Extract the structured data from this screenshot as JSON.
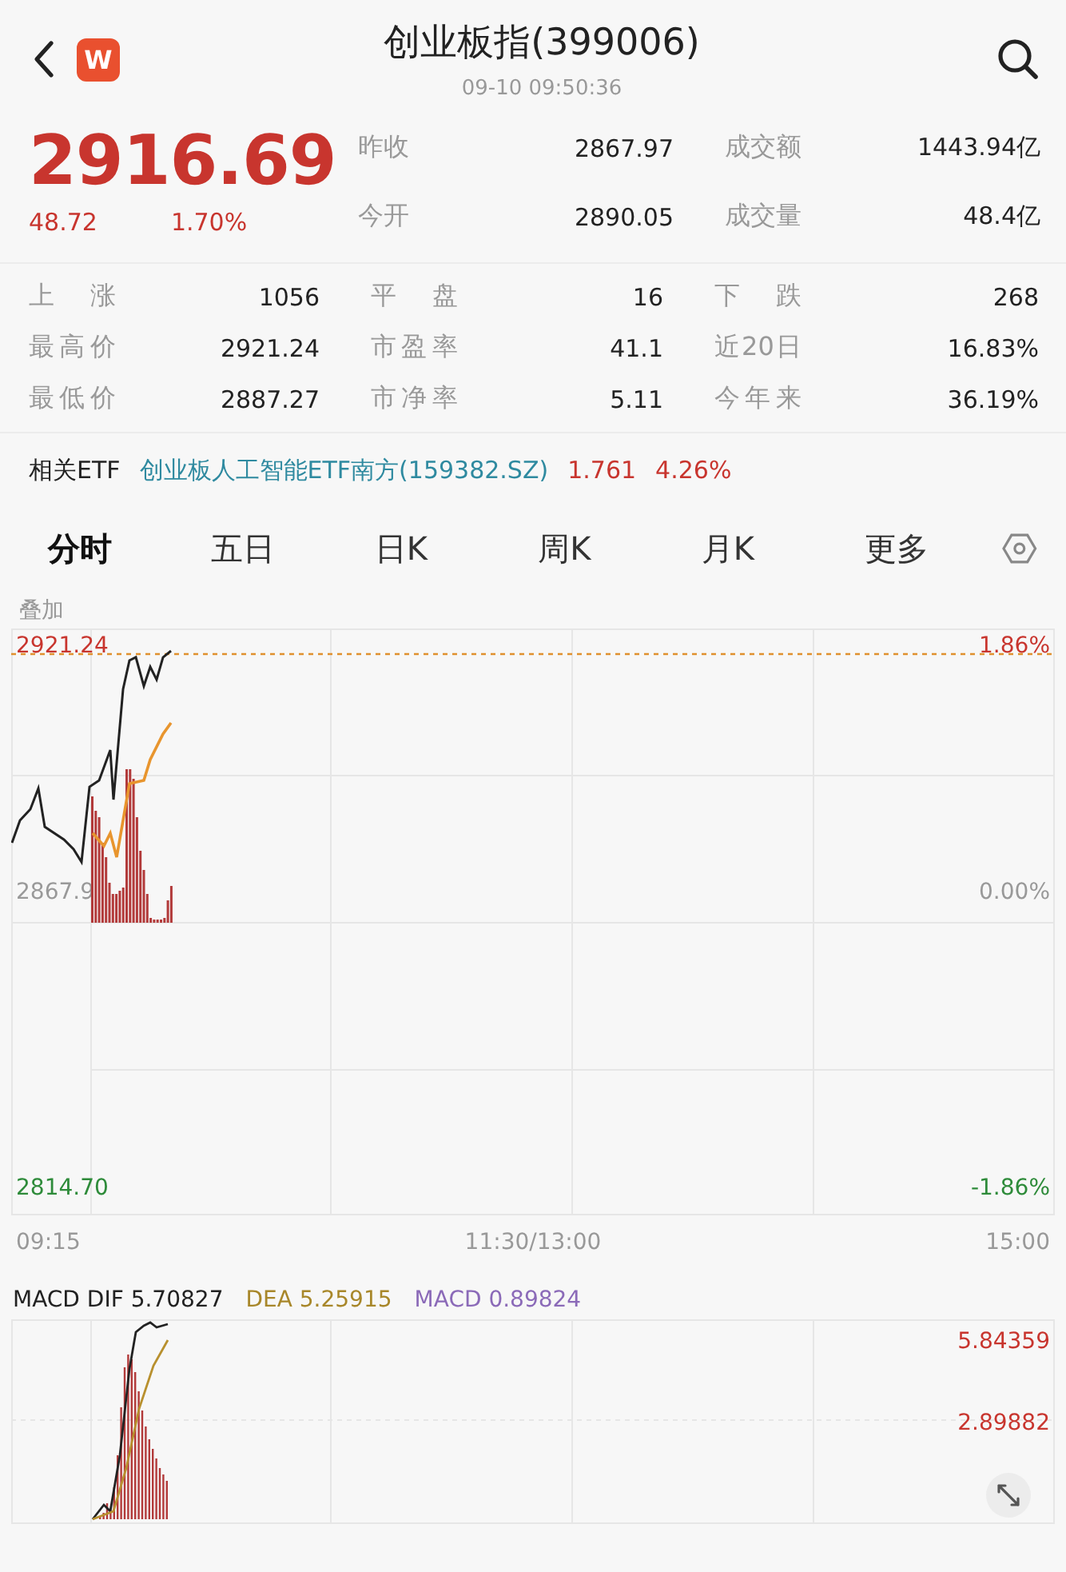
{
  "header": {
    "logo": "W",
    "title": "创业板指(399006)",
    "datetime": "09-10 09:50:36"
  },
  "quote": {
    "price": "2916.69",
    "change": "48.72",
    "change_pct": "1.70%"
  },
  "top_stats": [
    {
      "label": "昨收",
      "value": "2867.97"
    },
    {
      "label": "成交额",
      "value": "1443.94亿"
    },
    {
      "label": "今开",
      "value": "2890.05"
    },
    {
      "label": "成交量",
      "value": "48.4亿"
    }
  ],
  "stats": [
    {
      "label": "上涨",
      "value": "1056"
    },
    {
      "label": "平盘",
      "value": "16"
    },
    {
      "label": "下跌",
      "value": "268"
    },
    {
      "label": "最高价",
      "value": "2921.24"
    },
    {
      "label": "市盈率",
      "value": "41.1"
    },
    {
      "label": "近20日",
      "value": "16.83%"
    },
    {
      "label": "最低价",
      "value": "2887.27"
    },
    {
      "label": "市净率",
      "value": "5.11"
    },
    {
      "label": "今年来",
      "value": "36.19%"
    }
  ],
  "etf": {
    "label": "相关ETF",
    "name": "创业板人工智能ETF南方(159382.SZ)",
    "price": "1.761",
    "change_pct": "4.26%"
  },
  "tabs": [
    {
      "label": "分时",
      "selected": true
    },
    {
      "label": "五日",
      "selected": false
    },
    {
      "label": "日K",
      "selected": false
    },
    {
      "label": "周K",
      "selected": false
    },
    {
      "label": "月K",
      "selected": false
    },
    {
      "label": "更多",
      "selected": false
    }
  ],
  "price_chart": {
    "overlay": "叠加",
    "high_label": "2921.24",
    "high_pct": "1.86%",
    "base_label": "2867.9",
    "base_pct": "0.00%",
    "low_label": "2814.70",
    "low_pct": "-1.86%",
    "x_labels": [
      "09:15",
      "11:30/13:00",
      "15:00"
    ]
  },
  "macd": {
    "dif": "MACD DIF 5.70827",
    "dea": "DEA 5.25915",
    "macd": "MACD 0.89824",
    "upper": "5.84359",
    "middle": "2.89882"
  }
}
